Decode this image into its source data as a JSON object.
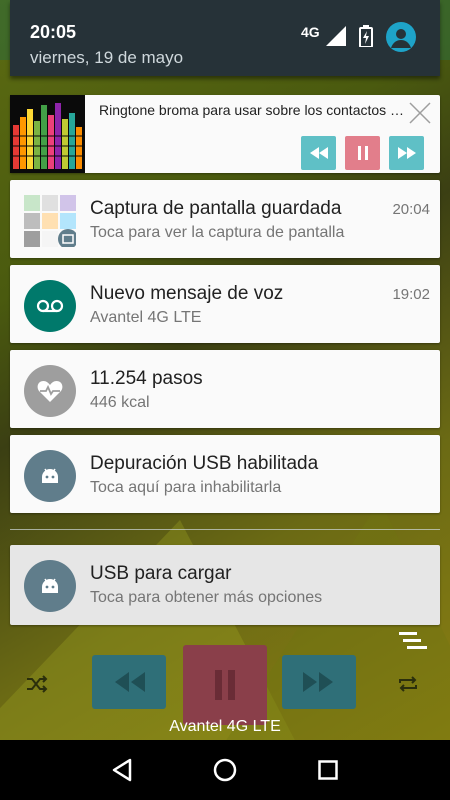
{
  "status_bar": {
    "clock": "20:05",
    "date": "viernes, 19 de mayo",
    "network": "4G",
    "icons": [
      "signal-icon",
      "battery-charging-icon",
      "user-avatar-icon"
    ]
  },
  "media": {
    "title": "Ringtone broma para usar sobre los contactos d...",
    "controls": [
      "previous-icon",
      "pause-icon",
      "next-icon"
    ],
    "colors": {
      "teal": "#5fc0c6",
      "pink": "#e27e8b"
    }
  },
  "notifications": [
    {
      "title": "Captura de pantalla guardada",
      "text": "Toca para ver la captura de pantalla",
      "time": "20:04",
      "icon": "screenshot-thumbnail"
    },
    {
      "title": "Nuevo mensaje de voz",
      "text": "Avantel 4G LTE",
      "time": "19:02",
      "icon": "voicemail-icon",
      "icon_color": "#00796b"
    },
    {
      "title": "11.254 pasos",
      "text": "446 kcal",
      "icon": "heart-pulse-icon",
      "icon_color": "#9e9e9e"
    },
    {
      "title": "Depuración USB habilitada",
      "text": "Toca aquí para inhabilitarla",
      "icon": "android-icon",
      "icon_color": "#607d8b"
    },
    {
      "title": "USB para cargar",
      "text": "Toca para obtener más opciones",
      "icon": "android-icon",
      "icon_color": "#607d8b"
    }
  ],
  "player": {
    "carrier": "Avantel 4G LTE",
    "controls": [
      "shuffle-icon",
      "rewind-icon",
      "pause-icon",
      "fast-forward-icon",
      "repeat-icon"
    ]
  },
  "navbar": {
    "buttons": [
      "back-icon",
      "home-icon",
      "recents-icon"
    ]
  }
}
